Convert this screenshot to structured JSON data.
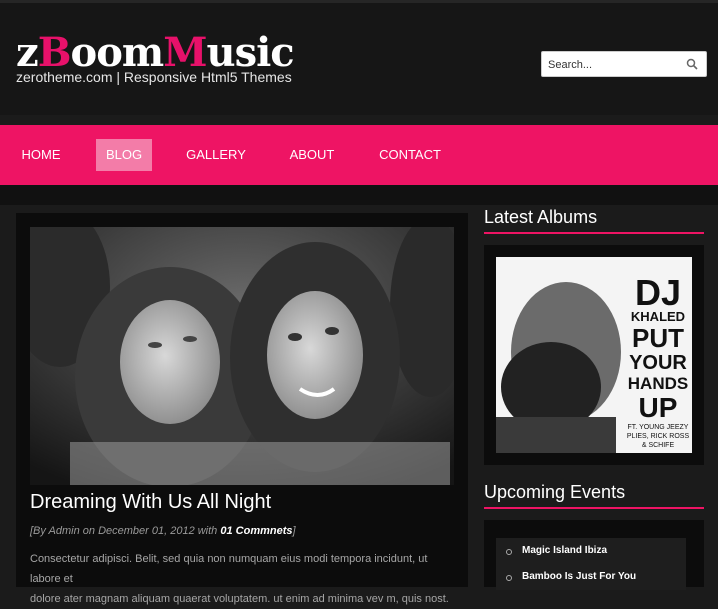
{
  "header": {
    "logo": {
      "part1": "z",
      "part2": "B",
      "part3": "oom",
      "part4": "M",
      "part5": "usic"
    },
    "tagline": "zerotheme.com | Responsive Html5 Themes",
    "search": {
      "placeholder": "Search...",
      "icon": "search-icon"
    }
  },
  "nav": {
    "items": [
      {
        "label": "HOME"
      },
      {
        "label": "BLOG"
      },
      {
        "label": "GALLERY"
      },
      {
        "label": "ABOUT"
      },
      {
        "label": "CONTACT"
      }
    ],
    "active": "BLOG"
  },
  "post": {
    "title": "Dreaming With Us All Night",
    "meta_prefix": "[By Admin on December 01, 2012 with ",
    "comments": "01 Commnets",
    "meta_suffix": "]",
    "excerpt_line1": "Consectetur adipisci. Belit, sed quia non numquam eius modi tempora incidunt, ut labore et",
    "excerpt_line2": "dolore ater magnam aliquam quaerat voluptatem. ut enim ad minima vev m, quis nost."
  },
  "sidebar": {
    "albums_title": "Latest Albums",
    "album_cover": {
      "line1": "DJ",
      "line2": "KHALED",
      "line3": "PUT",
      "line4": "YOUR",
      "line5": "HANDS",
      "line6": "UP",
      "line7": "FT. YOUNG JEEZY",
      "line8": "PLIES, RICK ROSS",
      "line9": "& SCHIFE"
    },
    "events_title": "Upcoming Events",
    "events": [
      {
        "label": "Magic Island Ibiza"
      },
      {
        "label": "Bamboo Is Just For You"
      }
    ]
  },
  "colors": {
    "accent": "#ee1464",
    "active_nav": "#f37ca8",
    "background": "#1b1b1b"
  }
}
